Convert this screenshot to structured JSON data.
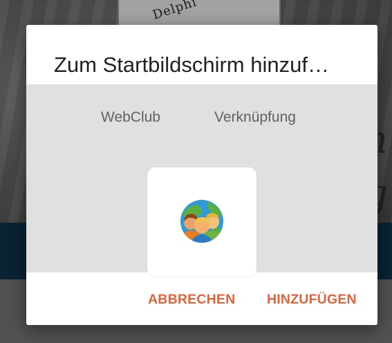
{
  "background": {
    "logo_text": "Delphi",
    "script_glyph_1": "n",
    "script_glyph_2": "g"
  },
  "dialog": {
    "title": "Zum Startbildschirm hinzuf…",
    "shortcut": {
      "name": "WebClub",
      "type": "Verknüpfung",
      "icon": "group-people-globe-icon"
    },
    "actions": {
      "cancel_label": "ABBRECHEN",
      "add_label": "HINZUFÜGEN"
    }
  },
  "colors": {
    "accent": "#e0633a",
    "dialog_background": "#ffffff",
    "content_background": "#e0e0e0",
    "title_text": "#212121",
    "secondary_text": "#616161"
  }
}
